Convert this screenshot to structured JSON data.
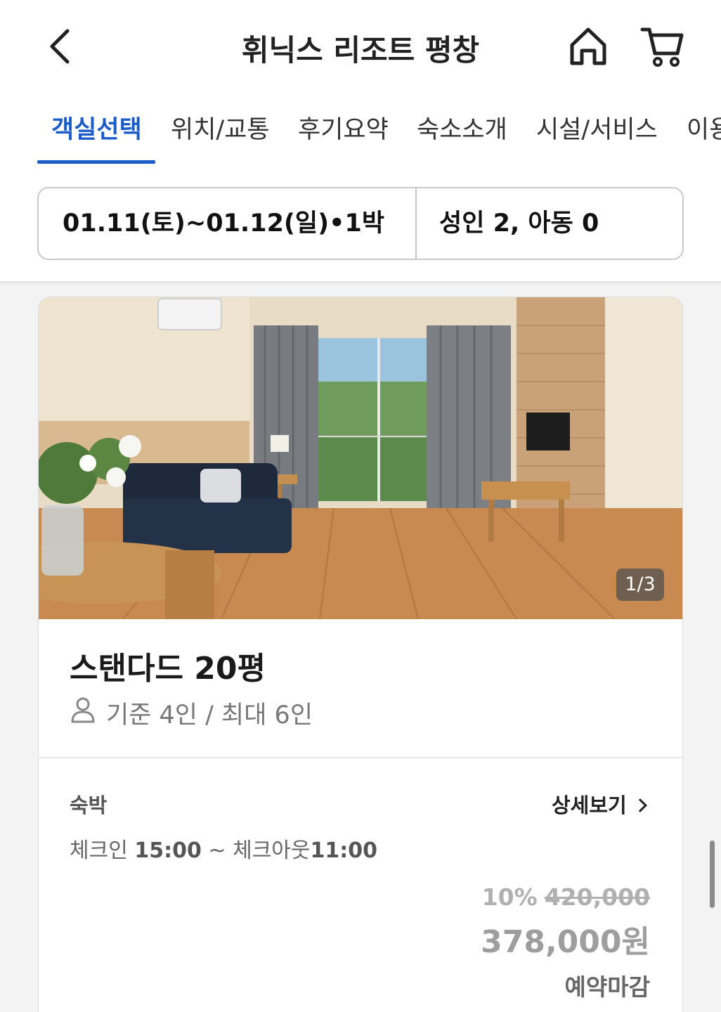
{
  "header": {
    "title": "휘닉스 리조트 평창"
  },
  "tabs": [
    {
      "label": "객실선택",
      "active": true
    },
    {
      "label": "위치/교통"
    },
    {
      "label": "후기요약"
    },
    {
      "label": "숙소소개"
    },
    {
      "label": "시설/서비스"
    },
    {
      "label": "이용"
    }
  ],
  "search": {
    "dates": "01.11(토)~01.12(일)•1박",
    "guests": "성인 2, 아동 0"
  },
  "room": {
    "photo_counter": "1/3",
    "name": "스탠다드 20평",
    "capacity": "기준 4인 / 최대 6인",
    "plan": {
      "label": "숙박",
      "detail_link": "상세보기",
      "checkin_label": "체크인",
      "checkin_time": "15:00",
      "separator": "~",
      "checkout_label": "체크아웃",
      "checkout_time": "11:00",
      "discount": "10%",
      "original_price": "420,000",
      "final_price": "378,000원",
      "status": "예약마감"
    }
  },
  "icons": {
    "back": "chevron-left-icon",
    "home": "home-icon",
    "cart": "cart-icon",
    "person": "person-icon"
  },
  "colors": {
    "accent": "#1b5cc8",
    "muted_price": "#9e9e9e"
  }
}
